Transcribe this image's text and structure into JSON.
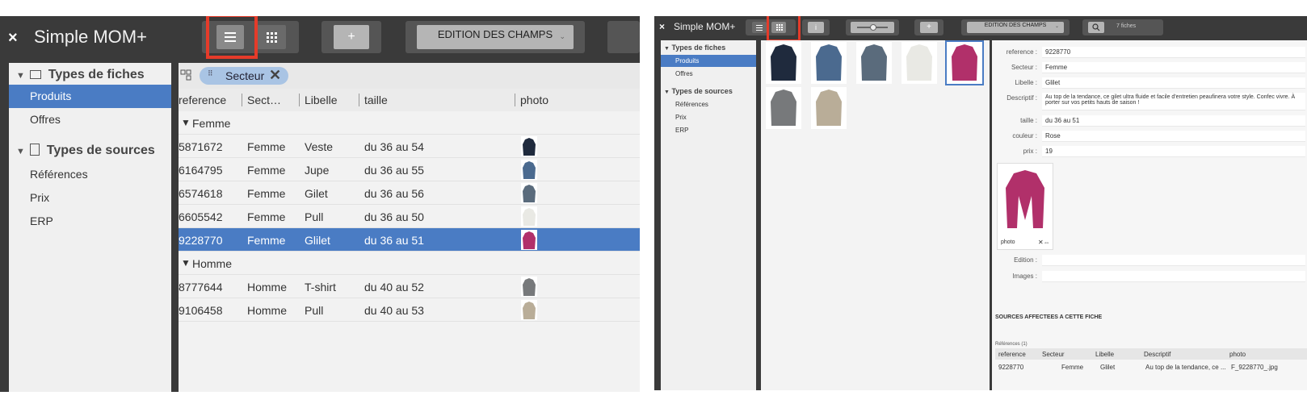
{
  "left": {
    "app_title": "Simple MOM+",
    "close_glyph": "×",
    "toolbar": {
      "list_view_icon": "list-icon",
      "grid_view_icon": "grid-icon",
      "add_label": "+",
      "edition_label": "EDITION DES CHAMPS"
    },
    "sidebar": {
      "types_fiches_label": "Types de fiches",
      "fiches_items": [
        "Produits",
        "Offres"
      ],
      "types_sources_label": "Types de sources",
      "sources_items": [
        "Références",
        "Prix",
        "ERP"
      ]
    },
    "chip_label": "Secteur",
    "columns": [
      "reference",
      "Sect…",
      "Libelle",
      "taille",
      "photo"
    ],
    "groups": [
      {
        "name": "Femme",
        "rows": [
          {
            "reference": "5871672",
            "secteur": "Femme",
            "libelle": "Veste",
            "taille": "du 36 au 54",
            "color": "#1f2a3d"
          },
          {
            "reference": "6164795",
            "secteur": "Femme",
            "libelle": "Jupe",
            "taille": "du 36 au 55",
            "color": "#4b6a8f"
          },
          {
            "reference": "6574618",
            "secteur": "Femme",
            "libelle": "Gilet",
            "taille": "du 36 au 56",
            "color": "#5a6b7c"
          },
          {
            "reference": "6605542",
            "secteur": "Femme",
            "libelle": "Pull",
            "taille": "du 36 au 50",
            "color": "#e9e9e4"
          },
          {
            "reference": "9228770",
            "secteur": "Femme",
            "libelle": "Glilet",
            "taille": "du 36 au 51",
            "color": "#b1306a",
            "selected": true
          }
        ]
      },
      {
        "name": "Homme",
        "rows": [
          {
            "reference": "8777644",
            "secteur": "Homme",
            "libelle": "T-shirt",
            "taille": "du 40 au 52",
            "color": "#77797b"
          },
          {
            "reference": "9106458",
            "secteur": "Homme",
            "libelle": "Pull",
            "taille": "du 40 au 53",
            "color": "#b9ad98"
          }
        ]
      }
    ]
  },
  "right": {
    "app_title": "Simple MOM+",
    "close_glyph": "×",
    "toolbar": {
      "info_label": "i",
      "add_label": "+",
      "edition_label": "EDITION DES CHAMPS",
      "count_label": "7 fiches"
    },
    "sidebar": {
      "types_fiches_label": "Types de fiches",
      "fiches_items": [
        "Produits",
        "Offres"
      ],
      "types_sources_label": "Types de sources",
      "sources_items": [
        "Références",
        "Prix",
        "ERP"
      ]
    },
    "fields": [
      {
        "label": "reference :",
        "value": "9228770"
      },
      {
        "label": "Secteur :",
        "value": "Femme"
      },
      {
        "label": "Libelle :",
        "value": "Glilet"
      },
      {
        "label": "Descriptif :",
        "value": "Au top de la tendance, ce gilet ultra fluide et facile d'entretien peaufinera votre style. Confec vivre. À porter sur vos petits hauts de saison !"
      },
      {
        "label": "taille :",
        "value": "du 36 au 51"
      },
      {
        "label": "couleur :",
        "value": "Rose"
      },
      {
        "label": "prix :",
        "value": "19"
      }
    ],
    "photo_caption": "photo",
    "extra_fields": [
      "Edition :",
      "Images :"
    ],
    "sources_title": "SOURCES AFFECTEES A CETTE FICHE",
    "refs_count": "Références (1)",
    "table_columns": [
      "reference",
      "Secteur",
      "Libelle",
      "Descriptif",
      "photo"
    ],
    "table_row": [
      "9228770",
      "Femme",
      "Glilet",
      "Au top de la tendance, ce ...",
      "F_9228770_.jpg"
    ]
  }
}
